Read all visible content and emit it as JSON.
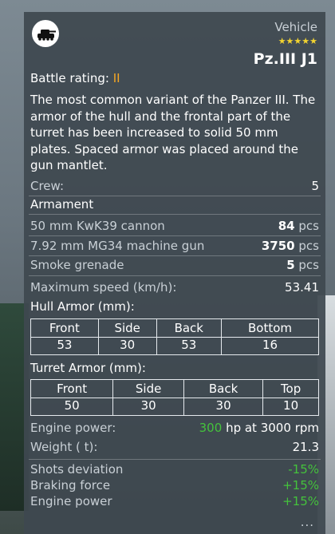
{
  "vehicle": {
    "tag": "Vehicle",
    "rank_stars": "★★★★★",
    "name": "Pz.III J1",
    "icon": "tank-icon"
  },
  "battle_rating": {
    "label": "Battle rating:",
    "value": "II"
  },
  "description": "The most common variant of the Panzer III. The armor of the hull and the frontal part of the turret has been increased to solid 50 mm plates. Spaced armor was placed around the gun mantlet.",
  "crew": {
    "label": "Crew:",
    "value": "5"
  },
  "armament": {
    "title": "Armament",
    "items": [
      {
        "name": "50 mm KwK39 cannon",
        "count": "84",
        "unit": "pcs"
      },
      {
        "name": "7.92 mm MG34 machine gun",
        "count": "3750",
        "unit": "pcs"
      },
      {
        "name": "Smoke grenade",
        "count": "5",
        "unit": "pcs"
      }
    ]
  },
  "max_speed": {
    "label": "Maximum speed (km/h):",
    "value": "53.41"
  },
  "hull_armor": {
    "label": "Hull Armor (mm):",
    "headers": [
      "Front",
      "Side",
      "Back",
      "Bottom"
    ],
    "values": [
      "53",
      "30",
      "53",
      "16"
    ]
  },
  "turret_armor": {
    "label": "Turret Armor (mm):",
    "headers": [
      "Front",
      "Side",
      "Back",
      "Top"
    ],
    "values": [
      "50",
      "30",
      "30",
      "10"
    ]
  },
  "engine_power": {
    "label": "Engine power:",
    "hp": "300",
    "hp_unit": "hp at",
    "rpm": "3000",
    "rpm_unit": "rpm"
  },
  "weight": {
    "label": "Weight ( t):",
    "value": "21.3"
  },
  "modifiers": [
    {
      "label": "Shots deviation",
      "value": "-15%"
    },
    {
      "label": "Braking force",
      "value": "+15%"
    },
    {
      "label": "Engine power",
      "value": "+15%"
    }
  ],
  "more": "...",
  "colors": {
    "accent_orange": "#f5a623",
    "positive_green": "#44c23c",
    "stars_yellow": "#f2d330"
  }
}
